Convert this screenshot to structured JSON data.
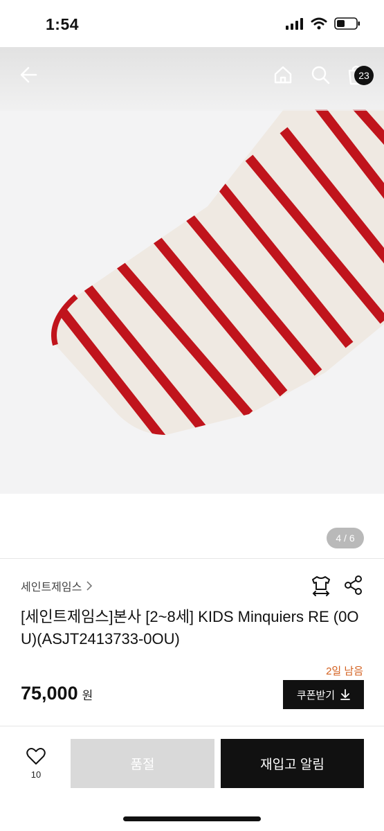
{
  "status_bar": {
    "time": "1:54"
  },
  "nav": {
    "cart_count": "23"
  },
  "gallery": {
    "pager": "4 / 6"
  },
  "product": {
    "brand": "세인트제임스",
    "title": "[세인트제임스]본사 [2~8세] KIDS Minquiers RE (0OU)(ASJT2413733-0OU)",
    "coupon_remaining": "2일 남음",
    "price": "75,000",
    "price_unit": "원",
    "coupon_button": "쿠폰받기"
  },
  "bottom": {
    "like_count": "10",
    "soldout_label": "품절",
    "restock_label": "재입고 알림"
  },
  "colors": {
    "accent": "#111111",
    "stripe": "#c0141c",
    "coupon_text": "#d35f1d"
  }
}
